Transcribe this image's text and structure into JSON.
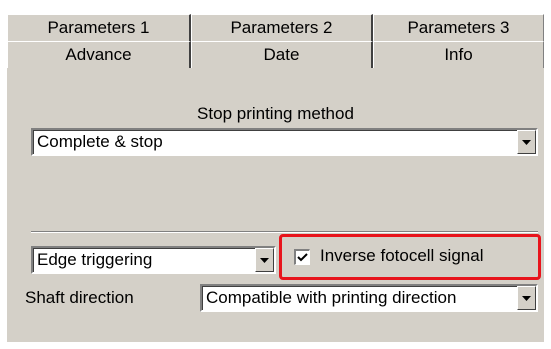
{
  "tabs": {
    "back_row": [
      "Parameters 1",
      "Parameters 2",
      "Parameters 3"
    ],
    "front_row": [
      "Advance",
      "Date",
      "Info"
    ]
  },
  "stop_printing": {
    "label": "Stop printing method",
    "value": "Complete & stop"
  },
  "trigger": {
    "value": "Edge triggering"
  },
  "inverse_signal": {
    "label": "Inverse fotocell signal",
    "checked": true
  },
  "shaft": {
    "label": "Shaft direction",
    "value": "Compatible with printing direction"
  },
  "icons": {
    "dropdown": "chevron-down-icon",
    "check": "checkmark-icon"
  },
  "colors": {
    "panel": "#d4d0c8",
    "highlight": "#e8141c"
  }
}
